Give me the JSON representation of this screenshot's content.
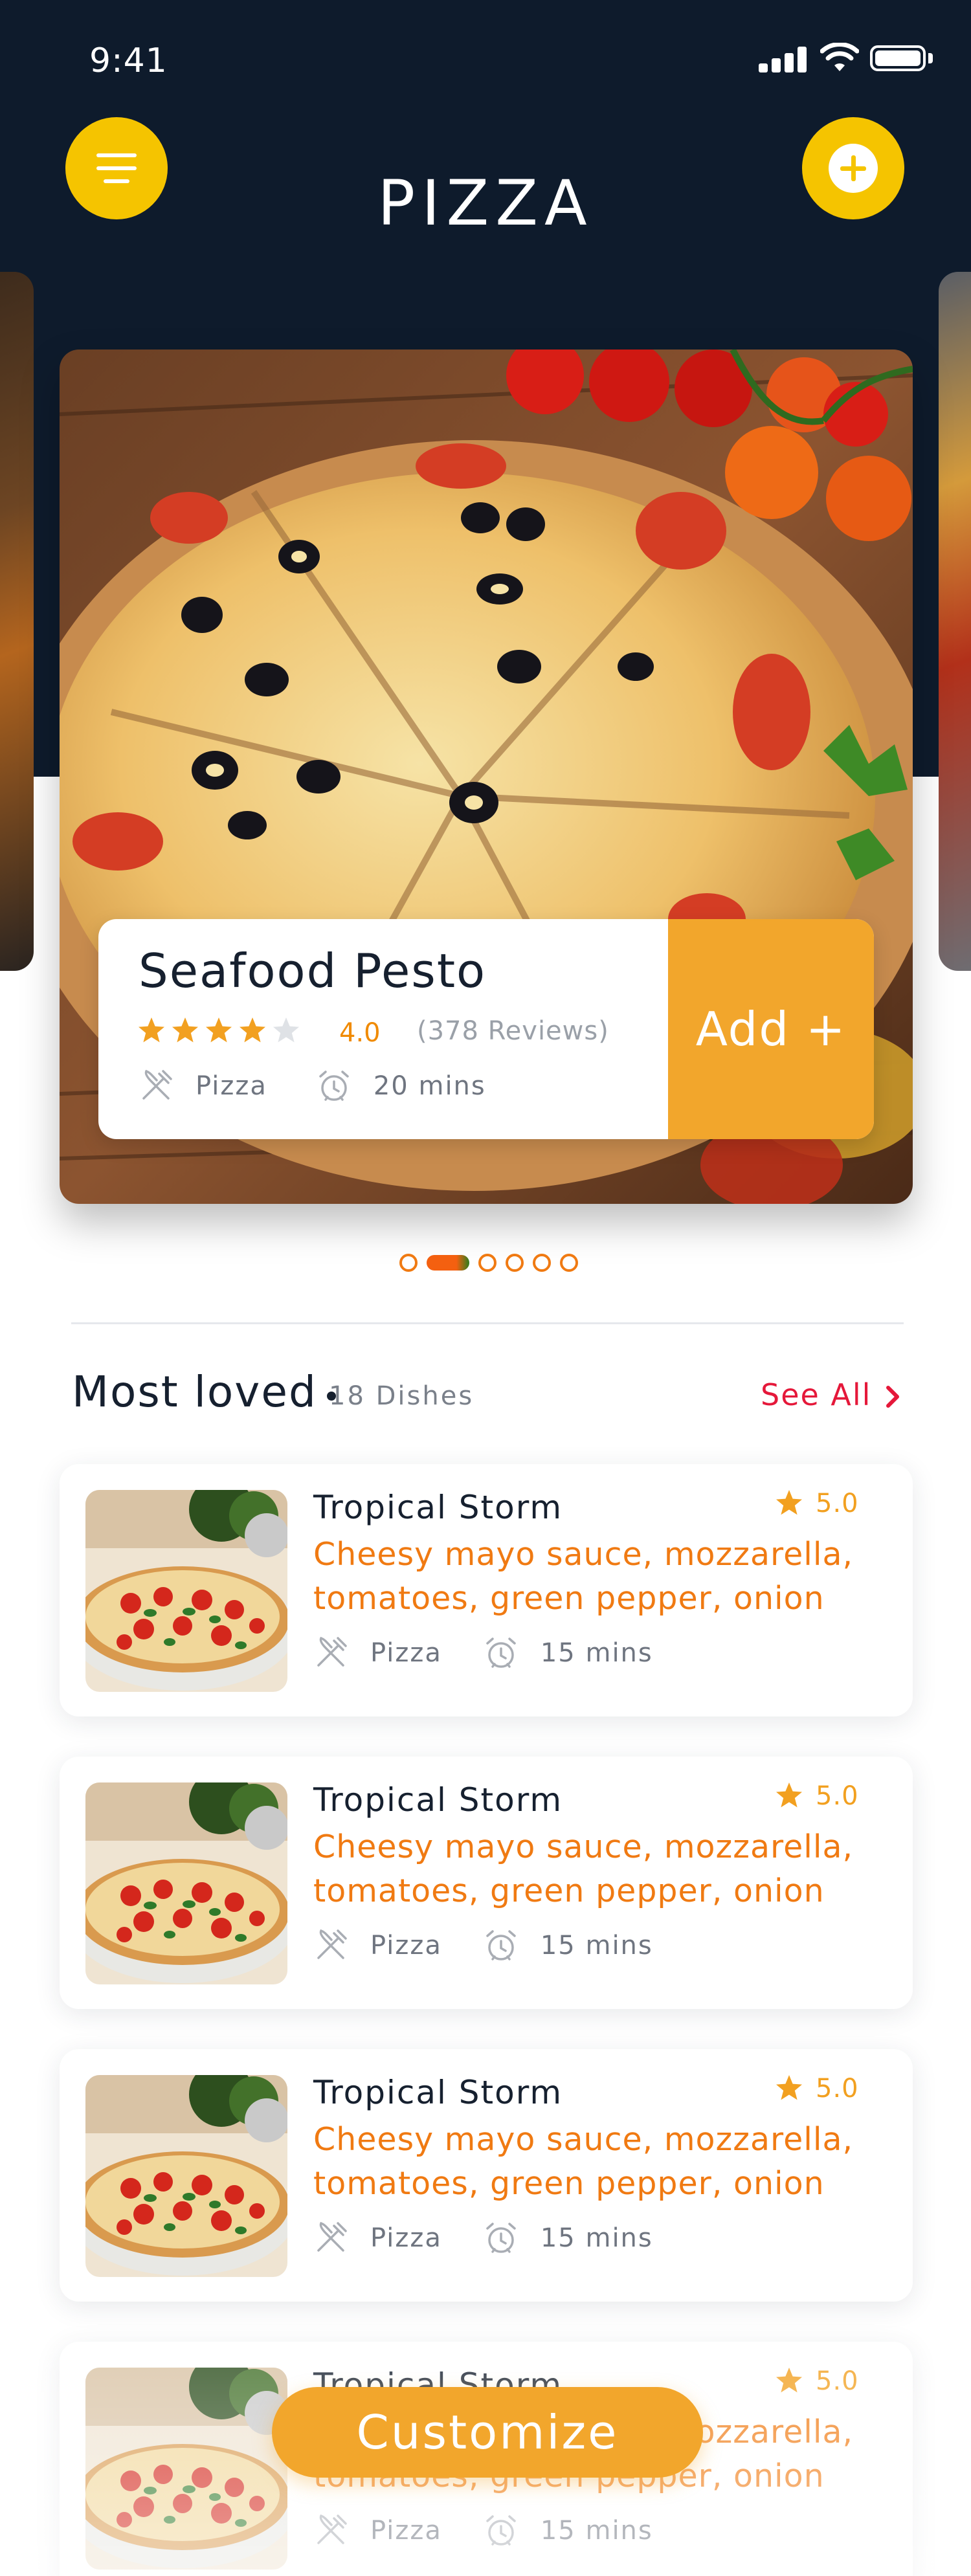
{
  "status_bar": {
    "time": "9:41"
  },
  "header": {
    "title": "PIZZA"
  },
  "featured": {
    "name": "Seafood Pesto",
    "rating": "4.0",
    "rating_value": 4,
    "reviews": "(378 Reviews)",
    "category": "Pizza",
    "time": "20 mins",
    "add_label": "Add +",
    "page_count": 6,
    "active_page": 2
  },
  "most_loved": {
    "title": "Most loved",
    "count": "18 Dishes",
    "see_all": "See All",
    "items": [
      {
        "name": "Tropical Storm",
        "rating": "5.0",
        "description": "Cheesy mayo sauce, mozzarella, tomatoes, green pepper, onion",
        "category": "Pizza",
        "time": "15 mins"
      },
      {
        "name": "Tropical Storm",
        "rating": "5.0",
        "description": "Cheesy mayo sauce, mozzarella, tomatoes, green pepper, onion",
        "category": "Pizza",
        "time": "15 mins"
      },
      {
        "name": "Tropical Storm",
        "rating": "5.0",
        "description": "Cheesy mayo sauce, mozzarella, tomatoes, green pepper, onion",
        "category": "Pizza",
        "time": "15 mins"
      },
      {
        "name": "Tropical Storm",
        "rating": "5.0",
        "description": "Cheesy mayo sauce, mozzarella, tomatoes, green pepper, onion",
        "category": "Pizza",
        "time": "15 mins"
      }
    ]
  },
  "customize_label": "Customize",
  "icons": {
    "menu": "hamburger-menu-icon",
    "add": "plus-circle-icon",
    "category": "fork-knife-icon",
    "time": "alarm-clock-icon",
    "rating": "star-icon",
    "see_all": "chevron-right-icon"
  },
  "colors": {
    "header_bg": "#0e1b2c",
    "accent_yellow": "#f5c400",
    "accent_orange": "#f2a62c",
    "desc_orange": "#f07a12",
    "see_all_red": "#e5183a"
  }
}
